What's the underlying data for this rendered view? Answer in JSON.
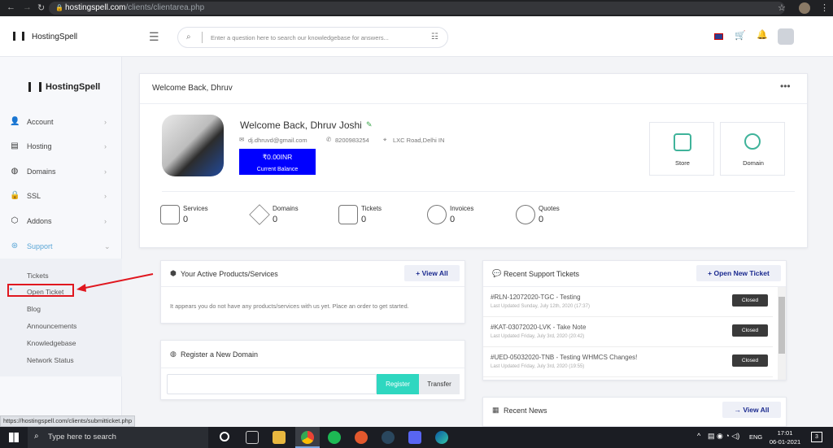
{
  "browser": {
    "url_host": "hostingspell.com",
    "url_path": "/clients/clientarea.php"
  },
  "app": {
    "brand": "HostingSpell",
    "logo_text": "HostingSpell",
    "search_placeholder": "Enter a question here to search our knowledgebase for answers..."
  },
  "sidebar": {
    "items": [
      {
        "label": "Account",
        "icon": "user-icon"
      },
      {
        "label": "Hosting",
        "icon": "server-icon"
      },
      {
        "label": "Domains",
        "icon": "globe-icon"
      },
      {
        "label": "SSL",
        "icon": "lock-icon"
      },
      {
        "label": "Addons",
        "icon": "cube-icon"
      },
      {
        "label": "Support",
        "icon": "lifebuoy-icon"
      }
    ],
    "support_sub": [
      "Tickets",
      "Open Ticket",
      "Blog",
      "Announcements",
      "Knowledgebase",
      "Network Status"
    ]
  },
  "welcome": {
    "header": "Welcome Back, Dhruv",
    "name": "Welcome Back, Dhruv Joshi",
    "email": "dj.dhruvd@gmail.com",
    "phone": "8200983254",
    "address": "LXC Road,Delhi IN",
    "balance": "₹0.00INR",
    "balance_label": "Current Balance",
    "store": "Store",
    "domain": "Domain"
  },
  "stats": [
    {
      "label": "Services",
      "value": "0"
    },
    {
      "label": "Domains",
      "value": "0"
    },
    {
      "label": "Tickets",
      "value": "0"
    },
    {
      "label": "Invoices",
      "value": "0"
    },
    {
      "label": "Quotes",
      "value": "0"
    }
  ],
  "products": {
    "title": "Your Active Products/Services",
    "view_all": "View All",
    "empty": "It appears you do not have any products/services with us yet. Place an order to get started."
  },
  "register": {
    "title": "Register a New Domain",
    "register_btn": "Register",
    "transfer_btn": "Transfer"
  },
  "tickets": {
    "title": "Recent Support Tickets",
    "open_new": "Open New Ticket",
    "items": [
      {
        "title": "#RLN-12072020-TGC - Testing",
        "date": "Last Updated Sunday, July 12th, 2020 (17:37)",
        "status": "Closed"
      },
      {
        "title": "#KAT-03072020-LVK - Take Note",
        "date": "Last Updated Friday, July 3rd, 2020 (20:42)",
        "status": "Closed"
      },
      {
        "title": "#UED-05032020-TNB - Testing WHMCS Changes!",
        "date": "Last Updated Friday, July 3rd, 2020 (19:55)",
        "status": "Closed"
      }
    ]
  },
  "news": {
    "title": "Recent News",
    "view_all": "View All"
  },
  "status_link": "https://hostingspell.com/clients/submitticket.php",
  "taskbar": {
    "search": "Type here to search",
    "time": "17:01",
    "date": "06-01-2021",
    "lang": "ENG",
    "notif": "3"
  },
  "colors": {
    "accent": "#1b2a8f",
    "balance": "#0000ff",
    "register": "#2fd7c0",
    "annotation": "#e0171f"
  }
}
